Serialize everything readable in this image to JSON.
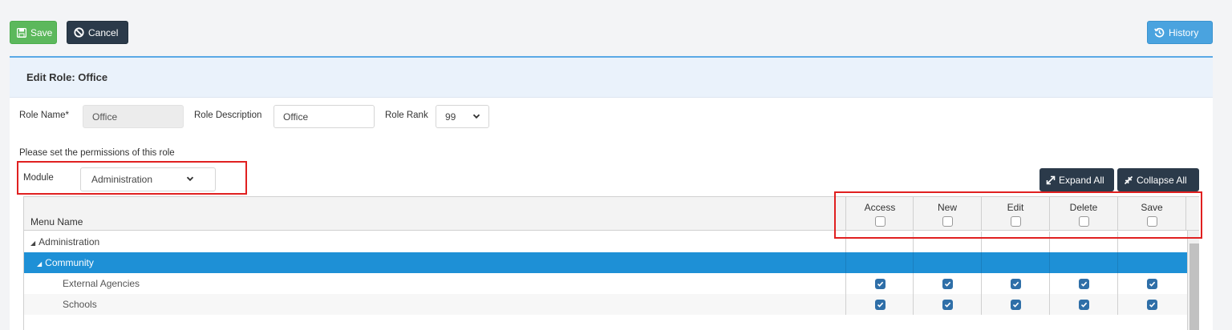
{
  "toolbar": {
    "save_label": "Save",
    "cancel_label": "Cancel",
    "history_label": "History"
  },
  "panel": {
    "title": "Edit Role: Office"
  },
  "form": {
    "role_name_label": "Role Name*",
    "role_name_value": "Office",
    "role_description_label": "Role Description",
    "role_description_value": "Office",
    "role_rank_label": "Role Rank",
    "role_rank_value": "99",
    "permissions_hint": "Please set the permissions of this role",
    "module_label": "Module",
    "module_value": "Administration"
  },
  "actions": {
    "expand_all": "Expand All",
    "collapse_all": "Collapse All"
  },
  "grid": {
    "menu_name_header": "Menu Name",
    "columns": [
      "Access",
      "New",
      "Edit",
      "Delete",
      "Save"
    ],
    "rows": [
      {
        "label": "Administration",
        "level": 0,
        "expandable": true,
        "selected": false,
        "permissions": null
      },
      {
        "label": "Community",
        "level": 1,
        "expandable": true,
        "selected": true,
        "permissions": null
      },
      {
        "label": "External Agencies",
        "level": 2,
        "expandable": false,
        "selected": false,
        "permissions": [
          true,
          true,
          true,
          true,
          true
        ]
      },
      {
        "label": "Schools",
        "level": 2,
        "expandable": false,
        "selected": false,
        "permissions": [
          true,
          true,
          true,
          true,
          true
        ]
      }
    ]
  },
  "colors": {
    "save_green": "#5cb85c",
    "dark_button": "#2b3a4a",
    "history_blue": "#4aa3df",
    "selected_row": "#1e90d6",
    "highlight_red": "#e02020"
  }
}
